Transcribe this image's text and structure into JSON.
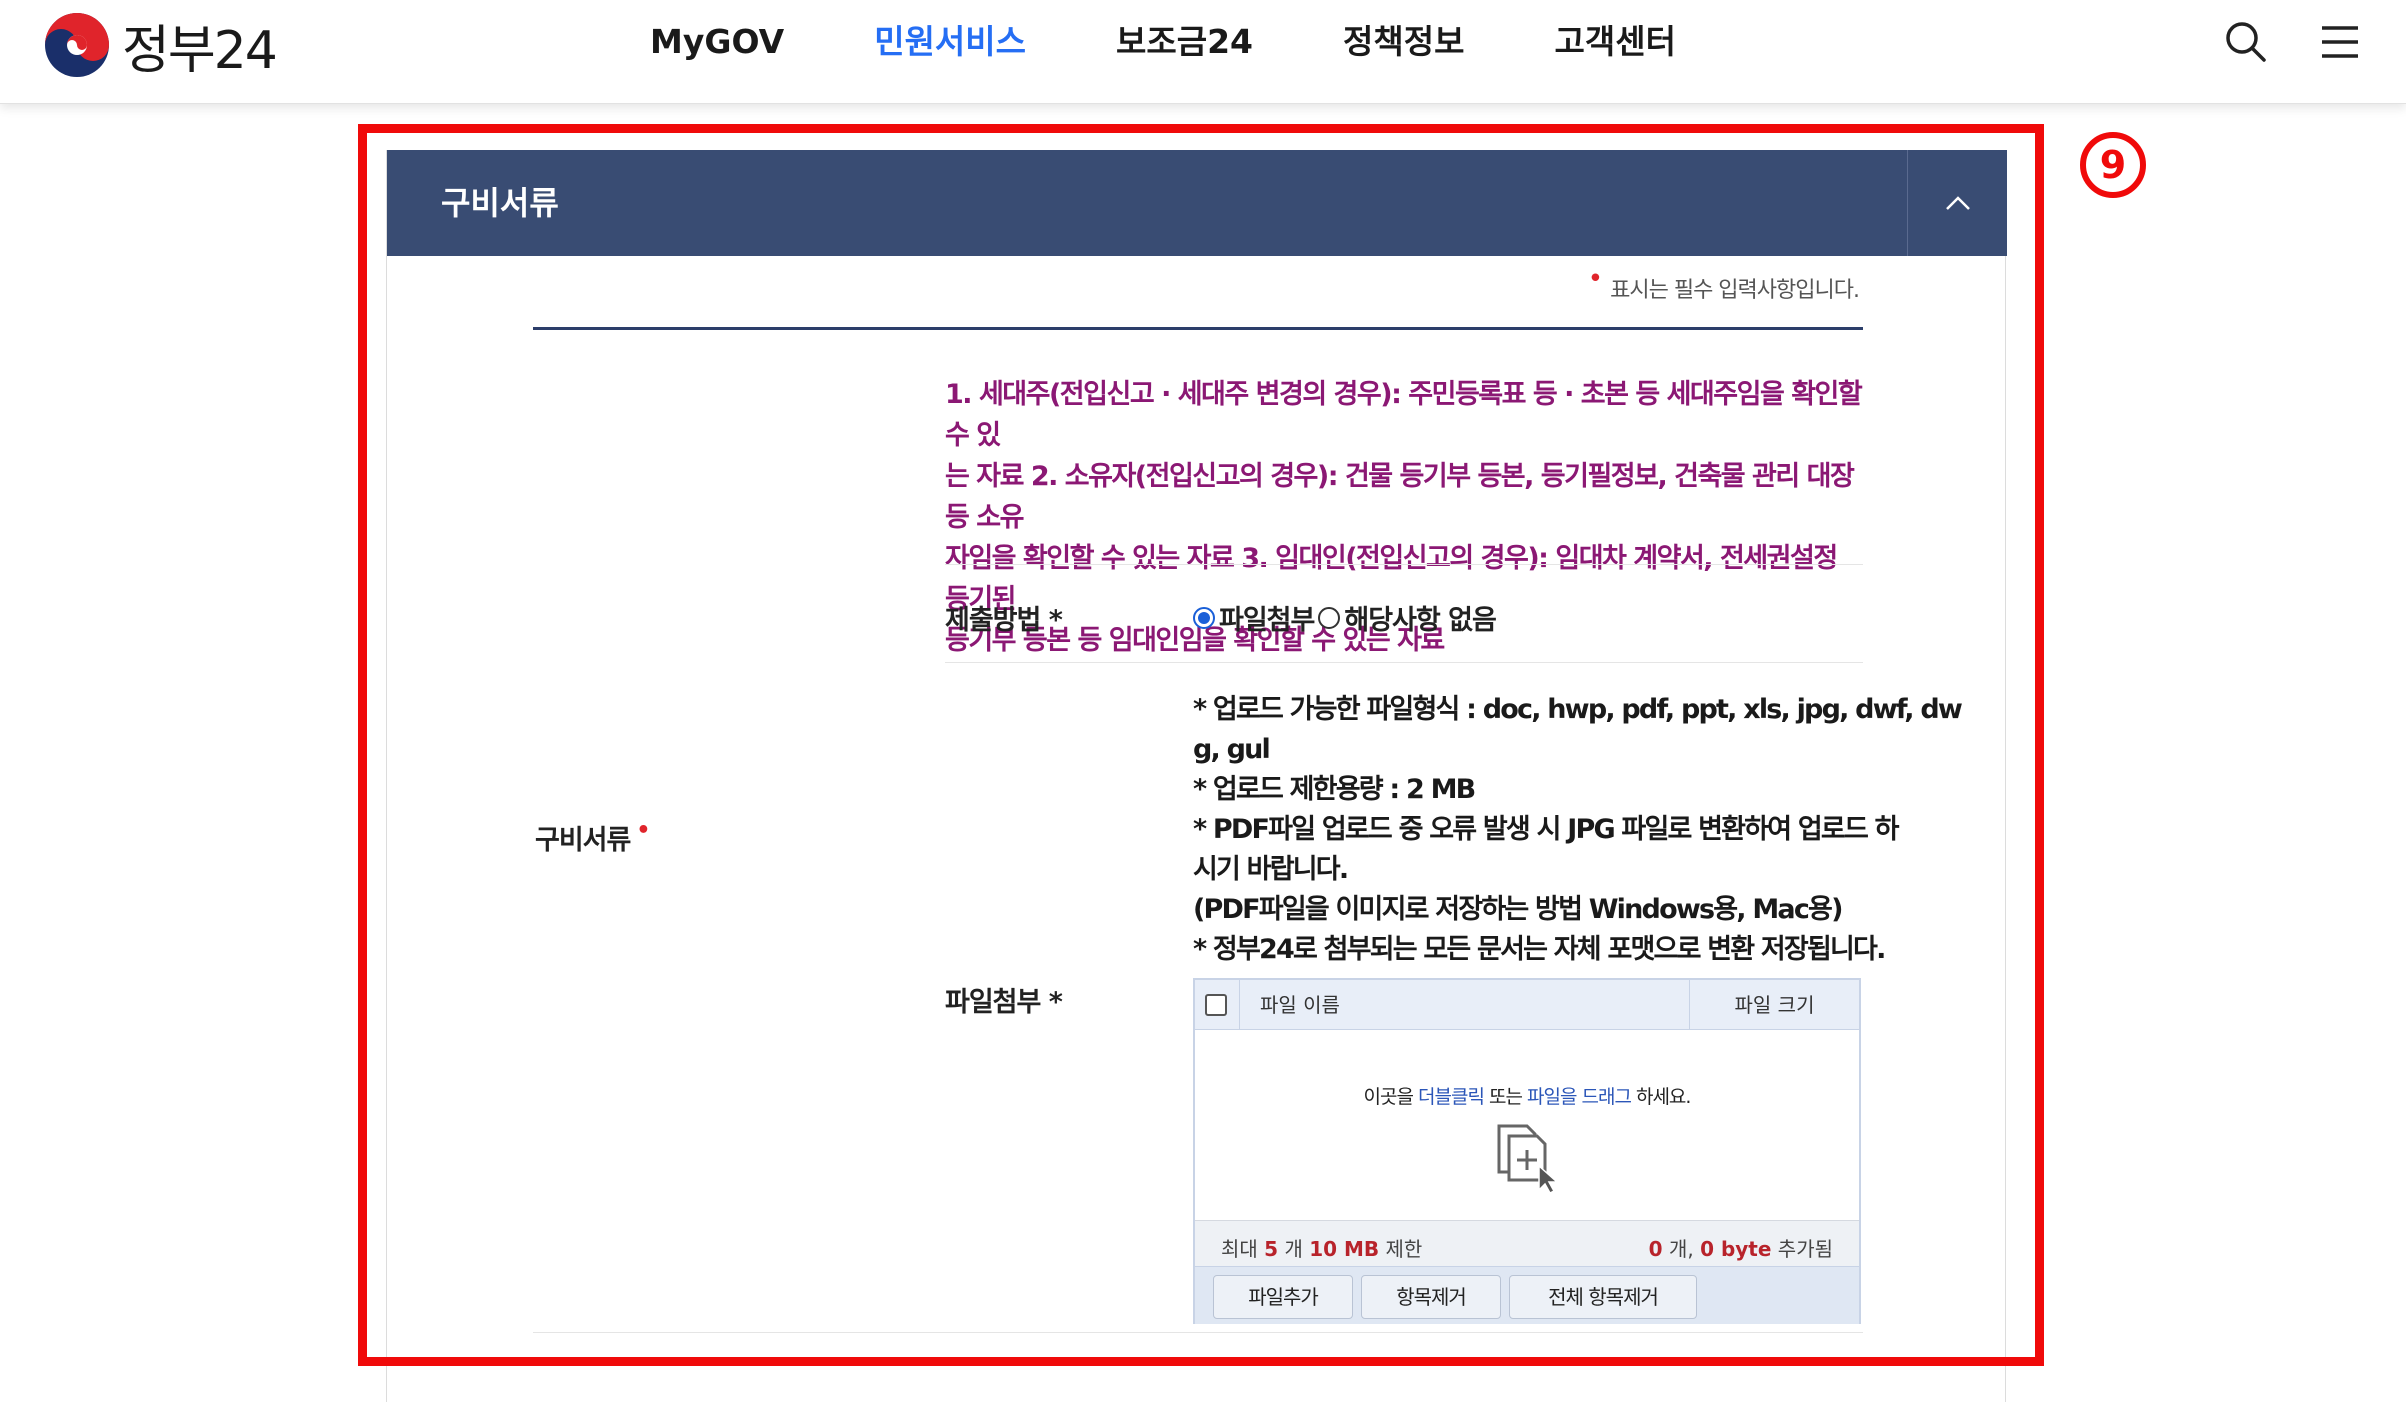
{
  "header": {
    "logo_text": "정부24",
    "nav": [
      "MyGOV",
      "민원서비스",
      "보조금24",
      "정책정보",
      "고객센터"
    ],
    "active_nav": "민원서비스"
  },
  "step_badge": "9",
  "panel": {
    "title": "구비서류",
    "required_note": "표시는 필수 입력사항입니다.",
    "description_lines": [
      "1. 세대주(전입신고 · 세대주 변경의 경우): 주민등록표 등 · 초본 등 세대주임을 확인할 수 있",
      "는 자료 2. 소유자(전입신고의 경우): 건물 등기부 등본, 등기필정보, 건축물 관리 대장 등 소유",
      "자임을 확인할 수 있는 자료 3. 임대인(전입신고의 경우): 임대차 계약서, 전세권설정 등기된",
      "등기부 등본 등 임대인임을 확인할 수 있는 자료"
    ],
    "main_label": "구비서류",
    "method": {
      "label": "제출방법 *",
      "options": [
        "파일첨부",
        "해당사항 없음"
      ],
      "selected": "파일첨부"
    },
    "attach": {
      "label": "파일첨부 *",
      "info_lines": [
        "* 업로드 가능한 파일형식 : doc, hwp, pdf, ppt, xls, jpg, dwf, dw",
        "g, gul",
        "* 업로드 제한용량 : 2 MB",
        "* PDF파일 업로드 중 오류 발생 시 JPG 파일로 변환하여 업로드 하",
        "시기 바랍니다.",
        " (PDF파일을 이미지로 저장하는 방법  Windows용, Mac용)",
        "* 정부24로 첨부되는 모든 문서는 자체 포맷으로 변환 저장됩니다."
      ]
    },
    "uploader": {
      "col_name": "파일 이름",
      "col_size": "파일 크기",
      "drop_pre": "이곳을 ",
      "drop_link1": "더블클릭",
      "drop_mid": " 또는 ",
      "drop_link2": "파일을 드래그",
      "drop_post": " 하세요.",
      "limit_pre": "최대 ",
      "limit_count": "5",
      "limit_mid": " 개 ",
      "limit_size": "10 MB",
      "limit_post": " 제한",
      "added_count": "0",
      "added_mid": " 개, ",
      "added_size": "0 byte",
      "added_post": " 추가됨",
      "buttons": [
        "파일추가",
        "항목제거",
        "전체 항목제거"
      ]
    }
  },
  "colors": {
    "panel_header": "#394c73",
    "description_text": "#8b1874",
    "highlight": "#f00a0a",
    "nav_active": "#256ef4"
  }
}
